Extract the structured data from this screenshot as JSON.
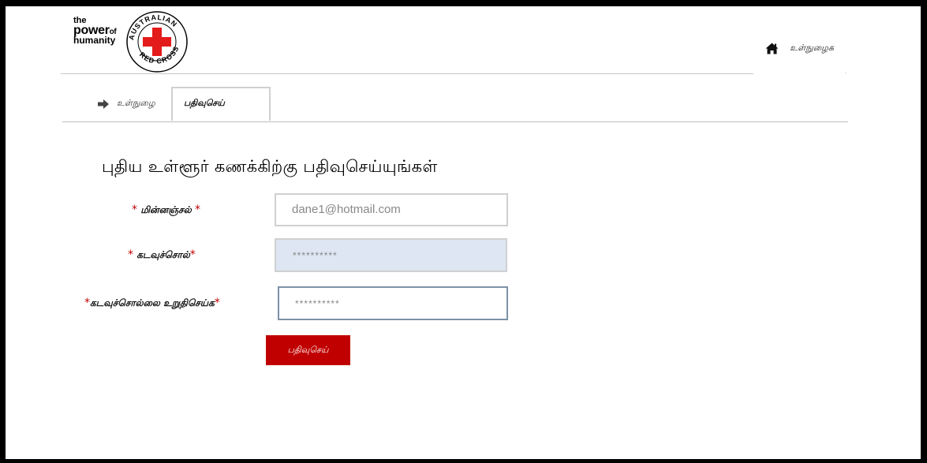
{
  "logo": {
    "line1": "the",
    "line2_main": "power",
    "line2_small": "of",
    "line3": "humanity",
    "seal_text": "AUSTRALIAN RED CROSS",
    "cross_color": "#e41b1b"
  },
  "nav": {
    "home_icon": "home-icon",
    "login_label": "உள்நுழைக"
  },
  "tabs": {
    "login_icon": "arrow-right-icon",
    "login_label": "உள்நுழை",
    "register_label": "பதிவுசெய்"
  },
  "form": {
    "title": "புதிய உள்ளூர் கணக்கிற்கு பதிவுசெய்யுங்கள்",
    "email": {
      "label": "மின்னஞ்சல்",
      "value": "dane1@hotmail.com"
    },
    "password": {
      "label": "கடவுச்சொல்",
      "value": "**********"
    },
    "confirm": {
      "label": "கடவுச்சொல்லை உறுதிசெய்க",
      "value": "**********"
    },
    "required_marker": "*",
    "submit_label": "பதிவுசெய்"
  },
  "colors": {
    "accent": "#c00000",
    "password_bg": "#dde6f2",
    "focus_border": "#7d91a8"
  }
}
